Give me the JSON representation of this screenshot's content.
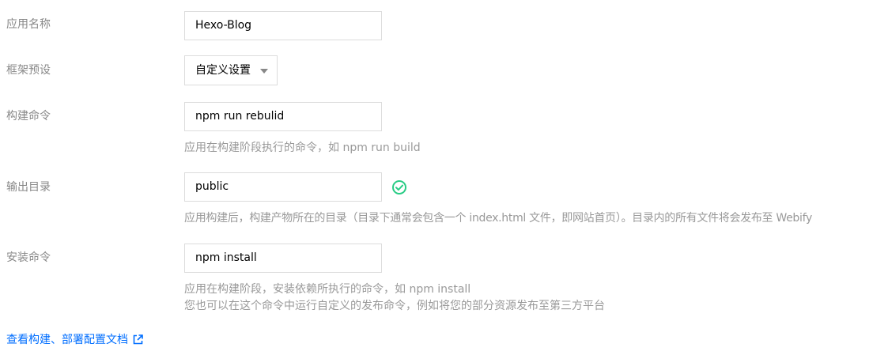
{
  "form": {
    "app_name": {
      "label": "应用名称",
      "value": "Hexo-Blog"
    },
    "framework": {
      "label": "框架预设",
      "value": "自定义设置"
    },
    "build_command": {
      "label": "构建命令",
      "value": "npm run rebulid",
      "hint": "应用在构建阶段执行的命令，如 npm run build"
    },
    "output_dir": {
      "label": "输出目录",
      "value": "public",
      "hint": "应用构建后，构建产物所在的目录（目录下通常会包含一个 index.html 文件，即网站首页）。目录内的所有文件将会发布至 Webify"
    },
    "install_command": {
      "label": "安装命令",
      "value": "npm install",
      "hint_line1": "应用在构建阶段，安装依赖所执行的命令，如 npm install",
      "hint_line2": "您也可以在这个命令中运行自定义的发布命令，例如将您的部分资源发布至第三方平台"
    }
  },
  "doc_link": {
    "label": "查看构建、部署配置文档",
    "icon": "external-link-icon"
  },
  "colors": {
    "label": "#888888",
    "hint": "#999999",
    "border": "#dcdcdc",
    "link": "#006eff",
    "success": "#29cc85"
  }
}
